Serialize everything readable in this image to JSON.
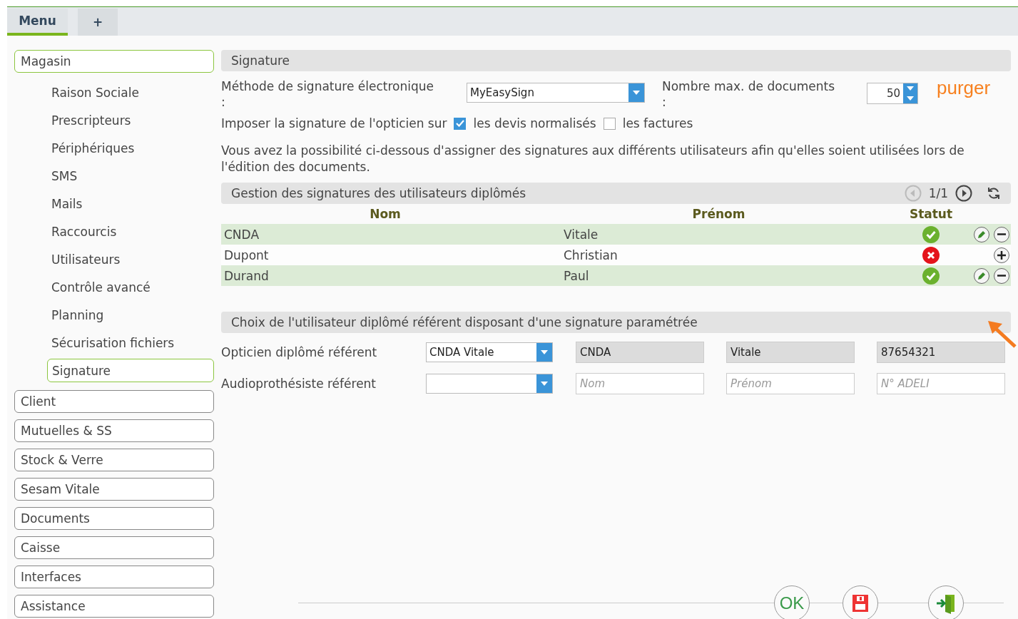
{
  "tabs": [
    {
      "label": "Menu",
      "selected": true
    },
    {
      "label": "+",
      "selected": false
    }
  ],
  "sidebar": {
    "items": [
      {
        "label": "Magasin",
        "expanded": true,
        "children": [
          {
            "label": "Raison Sociale",
            "selected": false
          },
          {
            "label": "Prescripteurs",
            "selected": false
          },
          {
            "label": "Périphériques",
            "selected": false
          },
          {
            "label": "SMS",
            "selected": false
          },
          {
            "label": "Mails",
            "selected": false
          },
          {
            "label": "Raccourcis",
            "selected": false
          },
          {
            "label": "Utilisateurs",
            "selected": false
          },
          {
            "label": "Contrôle avancé",
            "selected": false
          },
          {
            "label": "Planning",
            "selected": false
          },
          {
            "label": "Sécurisation fichiers",
            "selected": false
          },
          {
            "label": "Signature",
            "selected": true
          }
        ]
      },
      {
        "label": "Client",
        "expanded": false
      },
      {
        "label": "Mutuelles & SS",
        "expanded": false
      },
      {
        "label": "Stock & Verre",
        "expanded": false
      },
      {
        "label": "Sesam Vitale",
        "expanded": false
      },
      {
        "label": "Documents",
        "expanded": false
      },
      {
        "label": "Caisse",
        "expanded": false
      },
      {
        "label": "Interfaces",
        "expanded": false
      },
      {
        "label": "Assistance",
        "expanded": false
      }
    ]
  },
  "section_title": "Signature",
  "method": {
    "label": "Méthode de signature électronique\n:",
    "value": "MyEasySign"
  },
  "max_docs": {
    "label": "Nombre max. de documents\n:",
    "value": "50"
  },
  "purge_link": "purger",
  "impose": {
    "label": "Imposer la signature de l'opticien sur",
    "options": [
      {
        "label": "les devis normalisés",
        "checked": true
      },
      {
        "label": "les factures",
        "checked": false
      }
    ]
  },
  "info_text": "Vous avez la possibilité ci-dessous d'assigner des signatures aux différents utilisateurs afin qu'elles soient utilisées lors de l'édition des documents.",
  "users_table": {
    "title": "Gestion des signatures des utilisateurs diplômés",
    "pager": "1/1",
    "columns": [
      "Nom",
      "Prénom",
      "Statut"
    ],
    "rows": [
      {
        "nom": "CNDA",
        "prenom": "Vitale",
        "valid": true,
        "actions": [
          {
            "kind": "edit"
          },
          {
            "kind": "remove"
          }
        ]
      },
      {
        "nom": "Dupont",
        "prenom": "Christian",
        "valid": false,
        "actions": [
          {
            "kind": "add"
          }
        ]
      },
      {
        "nom": "Durand",
        "prenom": "Paul",
        "valid": true,
        "actions": [
          {
            "kind": "edit"
          },
          {
            "kind": "remove"
          }
        ]
      }
    ]
  },
  "referent": {
    "title": "Choix de l'utilisateur diplômé référent disposant d'une signature paramétrée",
    "rows": [
      {
        "label": "Opticien diplômé référent",
        "select": "CNDA Vitale",
        "disabled": true,
        "fields": [
          {
            "value": "CNDA"
          },
          {
            "value": "Vitale"
          },
          {
            "value": "87654321"
          }
        ]
      },
      {
        "label": "Audioprothésiste référent",
        "disabled": false,
        "fields": [
          {
            "placeholder": "Nom"
          },
          {
            "placeholder": "Prénom"
          },
          {
            "placeholder": "N° ADELI"
          }
        ]
      }
    ]
  },
  "footer": {
    "ok": "OK"
  }
}
